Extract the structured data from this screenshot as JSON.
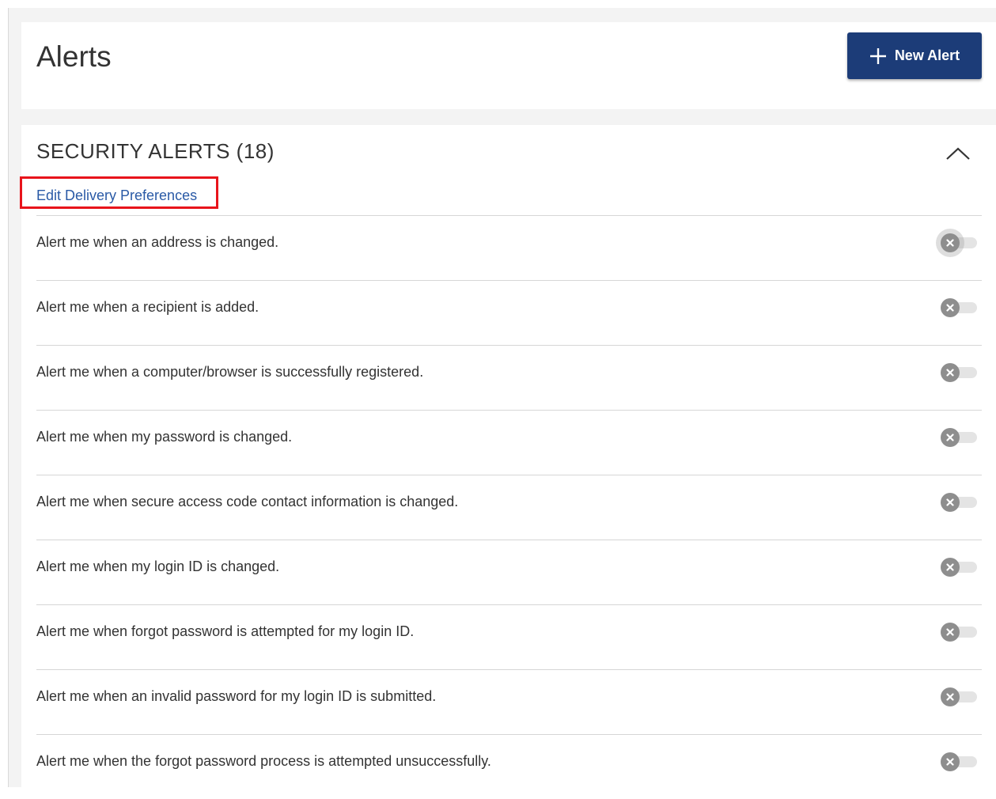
{
  "header": {
    "title": "Alerts",
    "new_alert_label": "New Alert"
  },
  "section": {
    "title": "SECURITY ALERTS (18)",
    "edit_delivery_label": "Edit Delivery Preferences",
    "expanded": true
  },
  "alerts": [
    {
      "label": "Alert me when an address is changed.",
      "enabled": false
    },
    {
      "label": "Alert me when a recipient is added.",
      "enabled": false
    },
    {
      "label": "Alert me when a computer/browser is successfully registered.",
      "enabled": false
    },
    {
      "label": "Alert me when my password is changed.",
      "enabled": false
    },
    {
      "label": "Alert me when secure access code contact information is changed.",
      "enabled": false
    },
    {
      "label": "Alert me when my login ID is changed.",
      "enabled": false
    },
    {
      "label": "Alert me when forgot password is attempted for my login ID.",
      "enabled": false
    },
    {
      "label": "Alert me when an invalid password for my login ID is submitted.",
      "enabled": false
    },
    {
      "label": "Alert me when the forgot password process is attempted unsuccessfully.",
      "enabled": false
    }
  ],
  "colors": {
    "primary_button": "#1c3c78",
    "link": "#2a5aa6",
    "highlight_box": "#e8141b",
    "toggle_off_knob": "#8e8e8e",
    "toggle_off_track": "#e4e4e4"
  },
  "icons": {
    "new_alert": "plus-icon",
    "collapse": "chevron-up-icon",
    "toggle_off": "close-x-icon"
  }
}
